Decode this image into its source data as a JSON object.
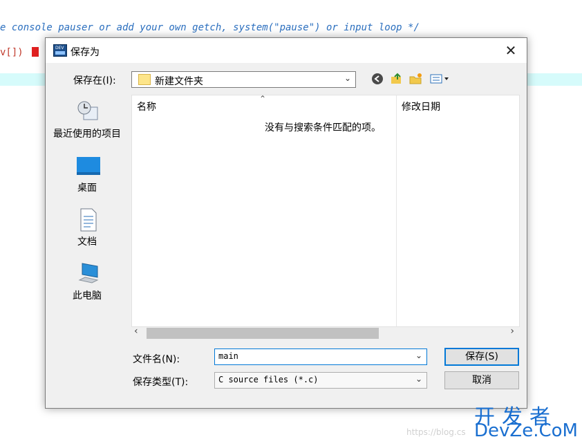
{
  "editor": {
    "line_comment": "e console pauser or add your own getch, system(\"pause\") or input loop */",
    "line_code": "v[]) "
  },
  "dialog": {
    "app_icon_text": "DEV",
    "title": "保存为",
    "close_glyph": "✕",
    "save_in_label": "保存在(I):",
    "current_folder": "新建文件夹",
    "places": [
      {
        "label": "最近使用的项目",
        "icon": "recent-icon"
      },
      {
        "label": "桌面",
        "icon": "desktop-icon"
      },
      {
        "label": "文档",
        "icon": "documents-icon"
      },
      {
        "label": "此电脑",
        "icon": "this-pc-icon"
      }
    ],
    "columns": {
      "name": "名称",
      "date": "修改日期"
    },
    "empty_message": "没有与搜索条件匹配的项。",
    "filename_label": "文件名(N):",
    "filename_value": "main",
    "filetype_label": "保存类型(T):",
    "filetype_value": "C source files (*.c)",
    "save_button": "保存(S)",
    "cancel_button": "取消"
  },
  "watermark": {
    "url": "https://blog.cs",
    "brand_cn": "开发者",
    "brand_en": "DevZe.CoM"
  },
  "colors": {
    "accent": "#0078d7",
    "comment": "#2b6fbf",
    "watermark": "#1a6fd0"
  }
}
